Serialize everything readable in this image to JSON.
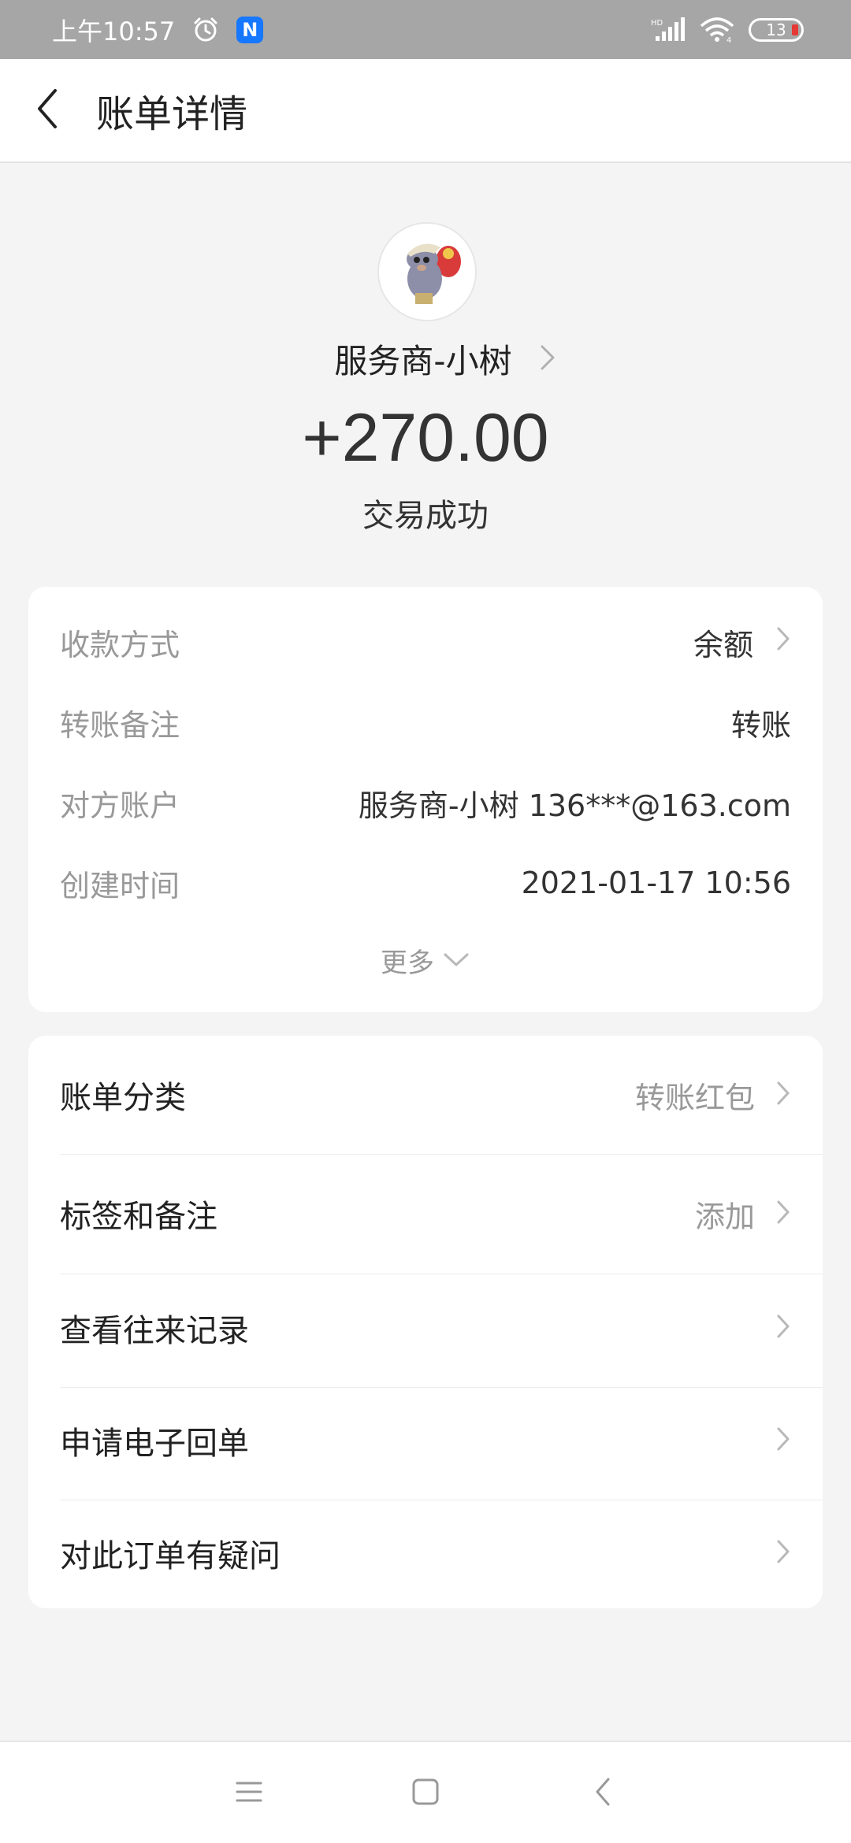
{
  "status_bar": {
    "time": "上午10:57",
    "battery": "13",
    "icons": [
      "alarm-icon",
      "n-app-icon",
      "hd-signal-icon",
      "wifi-icon",
      "battery-icon"
    ]
  },
  "header": {
    "title": "账单详情",
    "back_icon": "chevron-left-icon"
  },
  "summary": {
    "payer_name": "服务商-小树",
    "amount": "+270.00",
    "status": "交易成功"
  },
  "details": {
    "rows": [
      {
        "label": "收款方式",
        "value": "余额"
      },
      {
        "label": "转账备注",
        "value": "转账"
      },
      {
        "label": "对方账户",
        "value": "服务商-小树 136***@163.com"
      },
      {
        "label": "创建时间",
        "value": "2021-01-17 10:56"
      }
    ],
    "more_label": "更多"
  },
  "actions": {
    "items": [
      {
        "label": "账单分类",
        "value": "转账红包"
      },
      {
        "label": "标签和备注",
        "value": "添加"
      },
      {
        "label": "查看往来记录",
        "value": ""
      },
      {
        "label": "申请电子回单",
        "value": ""
      },
      {
        "label": "对此订单有疑问",
        "value": ""
      }
    ]
  },
  "nav": {
    "icons": [
      "menu-icon",
      "home-square-icon",
      "back-triangle-icon"
    ]
  },
  "colors": {
    "status_bar": "#a6a6a6",
    "background": "#f4f4f4",
    "card": "#ffffff",
    "secondary_text": "#999999",
    "primary_text": "#333333",
    "battery_low": "#e53935",
    "badge_blue": "#1677ff"
  }
}
